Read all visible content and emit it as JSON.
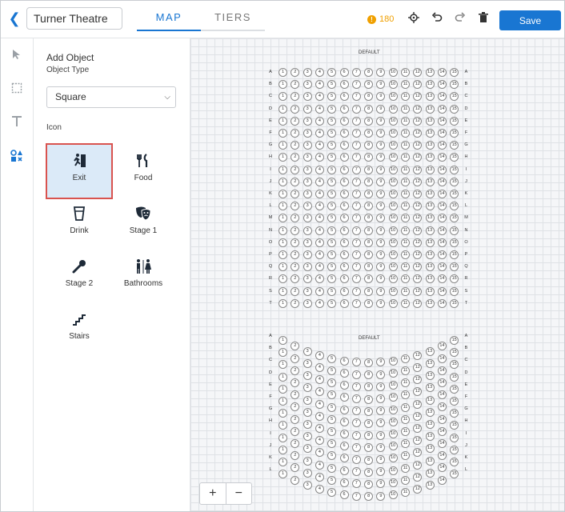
{
  "header": {
    "back_icon": "chevron-left-icon",
    "venue_name": "Turner Theatre",
    "tabs": [
      {
        "label": "MAP",
        "active": true
      },
      {
        "label": "TIERS",
        "active": false
      }
    ],
    "price": "180",
    "tools": [
      "crosshair-icon",
      "undo-icon",
      "redo-icon",
      "trash-icon"
    ],
    "save_label": "Save",
    "accent_color": "#1976d2"
  },
  "rail": {
    "tools": [
      "pointer-icon",
      "rectangle-select-icon",
      "text-icon",
      "shapes-icon"
    ],
    "active": "shapes-icon"
  },
  "panel": {
    "heading": "Add Object",
    "object_type_label": "Object Type",
    "object_type_value": "Square",
    "icon_label": "Icon",
    "icons": [
      {
        "label": "Exit",
        "icon": "exit-icon",
        "selected": true
      },
      {
        "label": "Food",
        "icon": "food-icon",
        "selected": false
      },
      {
        "label": "Drink",
        "icon": "drink-icon",
        "selected": false
      },
      {
        "label": "Stage 1",
        "icon": "theater-masks-icon",
        "selected": false
      },
      {
        "label": "Stage 2",
        "icon": "microphone-icon",
        "selected": false
      },
      {
        "label": "Bathrooms",
        "icon": "restroom-icon",
        "selected": false
      },
      {
        "label": "Stairs",
        "icon": "stairs-icon",
        "selected": false
      }
    ]
  },
  "canvas": {
    "sections": [
      {
        "label": "DEFAULT",
        "rows": [
          "A",
          "B",
          "C",
          "D",
          "E",
          "F",
          "G",
          "H",
          "I",
          "J",
          "K",
          "L",
          "M",
          "N",
          "O",
          "P",
          "Q",
          "R",
          "S",
          "T"
        ],
        "seats_per_row": 15,
        "shape": "rectangle"
      },
      {
        "label": "DEFAULT",
        "rows": [
          "A",
          "B",
          "C",
          "D",
          "E",
          "F",
          "G",
          "H",
          "I",
          "J",
          "K",
          "L"
        ],
        "seats_per_row": 15,
        "shape": "curved"
      }
    ],
    "zoom_in": "+",
    "zoom_out": "−"
  }
}
